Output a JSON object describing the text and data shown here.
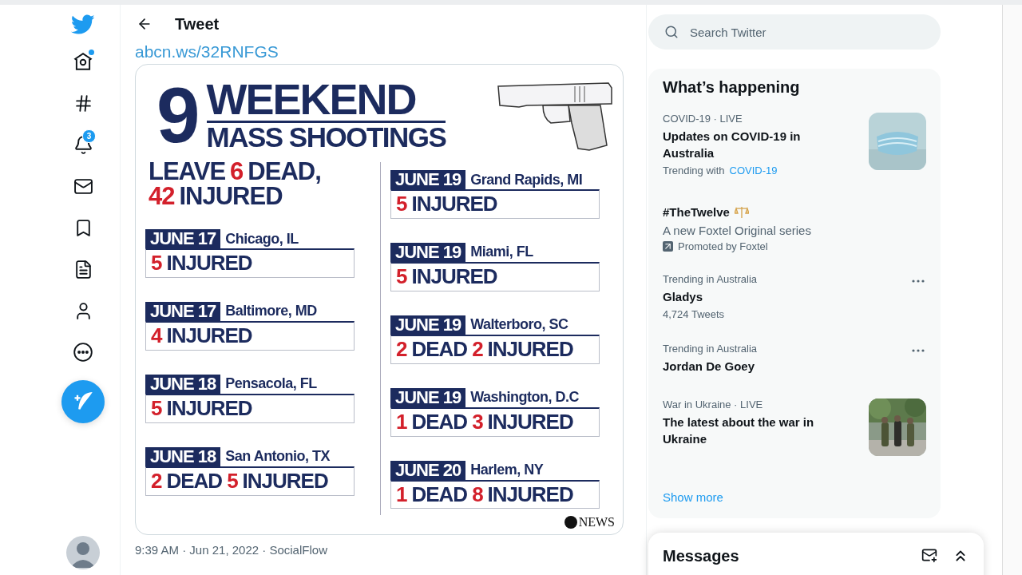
{
  "nav": {
    "items": [
      {
        "kind": "home",
        "selected": false,
        "dot": true
      },
      {
        "kind": "explore",
        "selected": false
      },
      {
        "kind": "notifications",
        "selected": false,
        "badge": "3"
      },
      {
        "kind": "messages",
        "selected": false
      },
      {
        "kind": "bookmarks",
        "selected": false
      },
      {
        "kind": "lists",
        "selected": false
      },
      {
        "kind": "profile",
        "selected": false
      },
      {
        "kind": "more",
        "selected": false
      }
    ]
  },
  "header": {
    "title": "Tweet"
  },
  "tweet": {
    "link": "abcn.ws/32RNFGS",
    "meta": "9:39 AM · Jun 21, 2022 · SocialFlow",
    "graphic": {
      "big_number": "9",
      "headline": "WEEKEND",
      "subheadline": "MASS SHOOTINGS",
      "summary": [
        [
          {
            "kind": "word",
            "text": "LEAVE"
          },
          {
            "kind": "number",
            "text": "6"
          },
          {
            "kind": "word",
            "text": "DEAD,"
          }
        ],
        [
          {
            "kind": "number",
            "text": "42"
          },
          {
            "kind": "word",
            "text": "INJURED"
          }
        ]
      ],
      "columns": [
        [
          {
            "date": "JUNE 17",
            "place": "Chicago, IL",
            "outcome": [
              {
                "number": "5",
                "label": "INJURED"
              }
            ]
          },
          {
            "date": "JUNE 17",
            "place": "Baltimore, MD",
            "outcome": [
              {
                "number": "4",
                "label": "INJURED"
              }
            ]
          },
          {
            "date": "JUNE 18",
            "place": "Pensacola, FL",
            "outcome": [
              {
                "number": "5",
                "label": "INJURED"
              }
            ]
          },
          {
            "date": "JUNE 18",
            "place": "San Antonio, TX",
            "outcome": [
              {
                "number": "2",
                "label": "DEAD"
              },
              {
                "number": "5",
                "label": "INJURED"
              }
            ]
          }
        ],
        [
          {
            "date": "JUNE 19",
            "place": "Grand Rapids, MI",
            "outcome": [
              {
                "number": "5",
                "label": "INJURED"
              }
            ]
          },
          {
            "date": "JUNE 19",
            "place": "Miami, FL",
            "outcome": [
              {
                "number": "5",
                "label": "INJURED"
              }
            ]
          },
          {
            "date": "JUNE 19",
            "place": "Walterboro, SC",
            "outcome": [
              {
                "number": "2",
                "label": "DEAD"
              },
              {
                "number": "2",
                "label": "INJURED"
              }
            ]
          },
          {
            "date": "JUNE 19",
            "place": "Washington, D.C",
            "outcome": [
              {
                "number": "1",
                "label": "DEAD"
              },
              {
                "number": "3",
                "label": "INJURED"
              }
            ]
          },
          {
            "date": "JUNE 20",
            "place": "Harlem, NY",
            "outcome": [
              {
                "number": "1",
                "label": "DEAD"
              },
              {
                "number": "8",
                "label": "INJURED"
              }
            ]
          }
        ]
      ],
      "credit": "NEWS"
    }
  },
  "search": {
    "placeholder": "Search Twitter"
  },
  "trends": {
    "title": "What’s happening",
    "items": [
      {
        "kind": "event",
        "context": "COVID-19 · LIVE",
        "title": "Updates on COVID-19 in Australia",
        "with_label": "Trending with",
        "with_link": "COVID-19"
      },
      {
        "kind": "promoted",
        "title": "#TheTwelve",
        "description": "A new Foxtel Original series",
        "promoted": "Promoted by Foxtel"
      },
      {
        "kind": "trend",
        "context": "Trending in Australia",
        "title": "Gladys",
        "count": "4,724 Tweets"
      },
      {
        "kind": "trend",
        "context": "Trending in Australia",
        "title": "Jordan De Goey"
      },
      {
        "kind": "event",
        "context": "War in Ukraine · LIVE",
        "title": "The latest about the war in Ukraine"
      }
    ],
    "show_more": "Show more"
  },
  "messages": {
    "title": "Messages"
  }
}
